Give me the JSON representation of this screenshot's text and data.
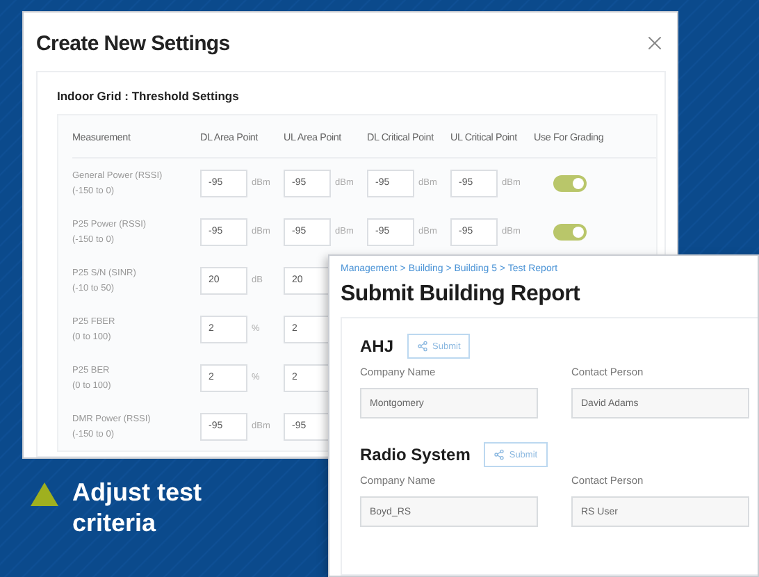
{
  "settings_dialog": {
    "title": "Create New Settings",
    "section_title": "Indoor Grid : Threshold Settings",
    "columns": [
      "Measurement",
      "DL Area Point",
      "UL Area Point",
      "DL Critical Point",
      "UL Critical Point",
      "Use For Grading"
    ],
    "rows": [
      {
        "name": "General Power (RSSI)",
        "range": "(-150 to 0)",
        "values": [
          {
            "value": "-95",
            "unit": "dBm"
          },
          {
            "value": "-95",
            "unit": "dBm"
          },
          {
            "value": "-95",
            "unit": "dBm"
          },
          {
            "value": "-95",
            "unit": "dBm"
          }
        ],
        "grading_on": true
      },
      {
        "name": "P25 Power (RSSI)",
        "range": "(-150 to 0)",
        "values": [
          {
            "value": "-95",
            "unit": "dBm"
          },
          {
            "value": "-95",
            "unit": "dBm"
          },
          {
            "value": "-95",
            "unit": "dBm"
          },
          {
            "value": "-95",
            "unit": "dBm"
          }
        ],
        "grading_on": true
      },
      {
        "name": "P25 S/N (SINR)",
        "range": "(-10 to 50)",
        "values": [
          {
            "value": "20",
            "unit": "dB"
          },
          {
            "value": "20"
          }
        ]
      },
      {
        "name": "P25 FBER",
        "range": "(0 to 100)",
        "values": [
          {
            "value": "2",
            "unit": "%"
          },
          {
            "value": "2"
          }
        ]
      },
      {
        "name": "P25 BER",
        "range": "(0 to 100)",
        "values": [
          {
            "value": "2",
            "unit": "%"
          },
          {
            "value": "2"
          }
        ]
      },
      {
        "name": "DMR Power (RSSI)",
        "range": "(-150 to 0)",
        "values": [
          {
            "value": "-95",
            "unit": "dBm"
          },
          {
            "value": "-95"
          }
        ]
      }
    ]
  },
  "report_window": {
    "breadcrumb": "Management > Building > Building 5 > Test Report",
    "title": "Submit Building Report",
    "sections": [
      {
        "title": "AHJ",
        "action": "Submit",
        "fields": [
          {
            "label": "Company Name",
            "value": "Montgomery"
          },
          {
            "label": "Contact Person",
            "value": "David Adams"
          }
        ]
      },
      {
        "title": "Radio System",
        "action": "Submit",
        "fields": [
          {
            "label": "Company Name",
            "value": "Boyd_RS"
          },
          {
            "label": "Contact Person",
            "value": "RS User"
          }
        ]
      }
    ]
  },
  "caption": "Adjust test criteria"
}
